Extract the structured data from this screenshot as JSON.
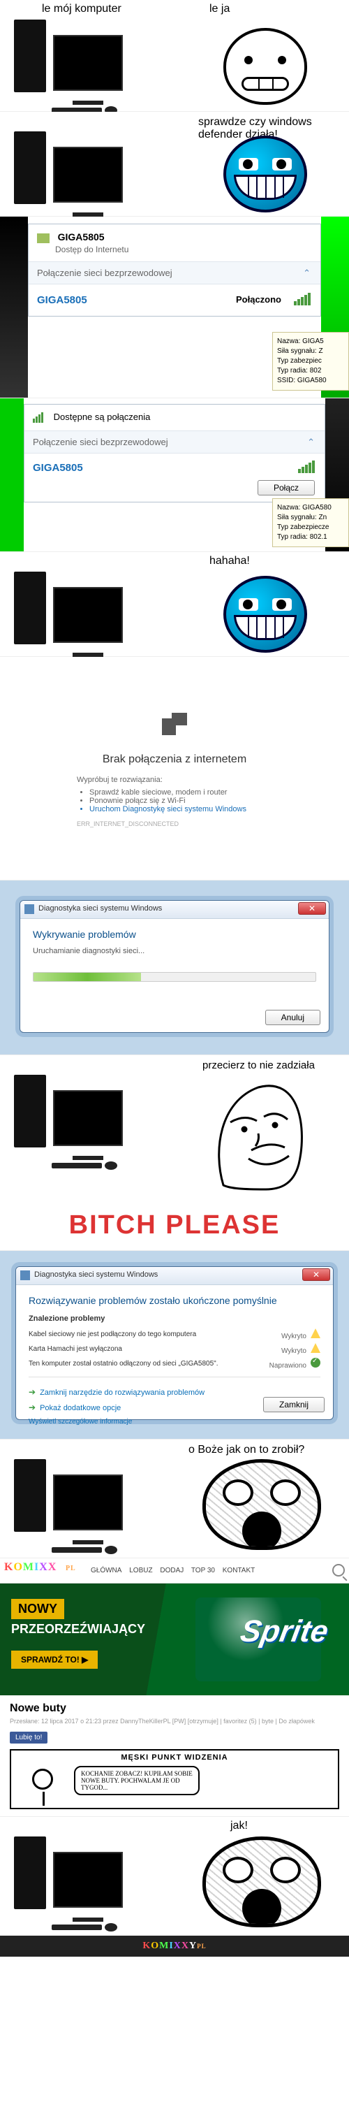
{
  "panel1": {
    "left_caption": "le mój komputer",
    "right_caption": "le ja"
  },
  "panel2": {
    "right_caption": "sprawdze czy windows defender działa!"
  },
  "panel3": {
    "ssid_header": "GIGA5805",
    "access": "Dostęp do Internetu",
    "section": "Połączenie sieci bezprzewodowej",
    "ssid": "GIGA5805",
    "status": "Połączono",
    "tip": {
      "l1": "Nazwa: GIGA5",
      "l2": "Siła sygnału: Z",
      "l3": "Typ zabezpiec",
      "l4": "Typ radia: 802",
      "l5": "SSID: GIGA580"
    }
  },
  "panel4": {
    "header": "Dostępne są połączenia",
    "section": "Połączenie sieci bezprzewodowej",
    "ssid": "GIGA5805",
    "button": "Połącz",
    "tip": {
      "l1": "Nazwa: GIGA580",
      "l2": "Siła sygnału: Zn",
      "l3": "Typ zabezpiecze",
      "l4": "Typ radia: 802.1"
    }
  },
  "panel5": {
    "right_caption": "hahaha!"
  },
  "panel6": {
    "title": "Brak połączenia z internetem",
    "try": "Wypróbuj te rozwiązania:",
    "bullets": [
      "Sprawdź kable sieciowe, modem i router",
      "Ponownie połącz się z Wi-Fi",
      "Uruchom Diagnostykę sieci systemu Windows"
    ],
    "err": "ERR_INTERNET_DISCONNECTED"
  },
  "panel7": {
    "title": "Diagnostyka sieci systemu Windows",
    "heading": "Wykrywanie problemów",
    "sub": "Uruchamianie diagnostyki sieci...",
    "cancel": "Anuluj"
  },
  "panel8": {
    "caption": "przecierz to nie zadziała",
    "text": "BITCH PLEASE"
  },
  "panel9": {
    "title": "Diagnostyka sieci systemu Windows",
    "heading": "Rozwiązywanie problemów zostało ukończone pomyślnie",
    "found": "Znalezione problemy",
    "items": [
      {
        "label": "Kabel sieciowy nie jest podłączony do tego komputera",
        "state": "Wykryto",
        "icon": "warn"
      },
      {
        "label": "Karta Hamachi jest wyłączona",
        "state": "Wykryto",
        "icon": "warn"
      },
      {
        "label": "Ten komputer został ostatnio odłączony od sieci „GIGA5805\".",
        "state": "Naprawiono",
        "icon": "check"
      }
    ],
    "opt1": "Zamknij narzędzie do rozwiązywania problemów",
    "opt2": "Pokaż dodatkowe opcje",
    "detail": "Wyświetl szczegółowe informacje",
    "close": "Zamknij"
  },
  "panel10": {
    "caption": "o Boże jak on to zrobił?"
  },
  "panel11": {
    "logo": "KOMIXXY",
    "nav": [
      "GŁÓWNA",
      "LOBUZ",
      "DODAJ",
      "TOP 30",
      "KONTAKT"
    ],
    "promo": {
      "l1": "NOWY",
      "l2": "PRZEORZEŹWIAJĄCY",
      "cta": "SPRAWDŹ TO! ▶"
    },
    "sprite": "Sprite",
    "post_title": "Nowe buty",
    "post_meta": "Przesłane: 12 lipca 2017 o 21:23 przez DannyTheKillerPL [PW] [otrzymuje] | favoritez (5) | byte | Do złapówek",
    "like": "Lubię to!",
    "comic_title": "MĘSKI PUNKT WIDZENIA",
    "bubble": "KOCHANIE ZOBACZ! KUPIŁAM SOBIE NOWE BUTY. POCHWALAM JE OD TYGOD..."
  },
  "panel12": {
    "caption": "jak!"
  },
  "footer": "KOMIXXYPL"
}
